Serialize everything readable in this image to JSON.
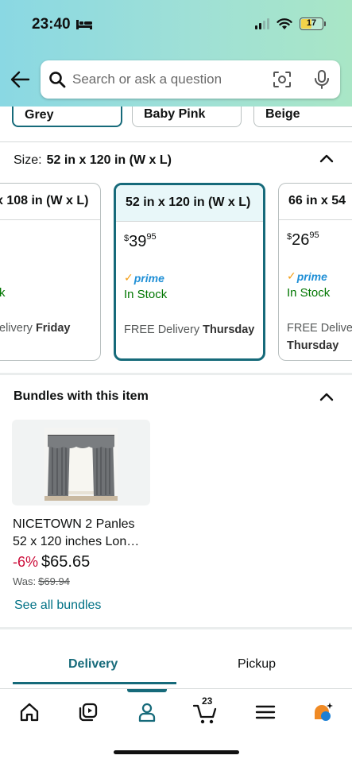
{
  "status_bar": {
    "time": "23:40",
    "battery": "17"
  },
  "search": {
    "placeholder": "Search or ask a question"
  },
  "colors": {
    "options": [
      "Grey",
      "Baby Pink",
      "Beige"
    ],
    "selected": "Grey"
  },
  "size": {
    "label": "Size:",
    "selected": "52 in x 120 in (W x L)",
    "cards": [
      {
        "title": "x 108 in (W x L)",
        "stock": "k",
        "delivery_prefix": "elivery",
        "delivery_day": "Friday"
      },
      {
        "title": "52 in x 120 in (W x L)",
        "price_currency": "$",
        "price_whole": "39",
        "price_fraction": "95",
        "prime_label": "prime",
        "stock": "In Stock",
        "delivery_prefix": "FREE Delivery",
        "delivery_day": "Thursday"
      },
      {
        "title": "66 in x 54",
        "price_currency": "$",
        "price_whole": "26",
        "price_fraction": "95",
        "prime_label": "prime",
        "stock": "In Stock",
        "delivery_prefix": "FREE Deliver",
        "delivery_day": "Thursday"
      }
    ]
  },
  "bundles": {
    "title": "Bundles with this item",
    "item": {
      "name_line1": "NICETOWN 2 Panles",
      "name_line2": "52 x 120 inches Lon…",
      "discount": "-6%",
      "price": "$65.65",
      "was_label": "Was:",
      "was_price": "$69.94"
    },
    "see_all": "See all bundles"
  },
  "tabs": {
    "delivery": "Delivery",
    "pickup": "Pickup",
    "active": "Delivery"
  },
  "bottom_nav": {
    "items": [
      "home",
      "inspire",
      "account",
      "cart",
      "menu",
      "rufus"
    ],
    "active": "account",
    "cart_count": "23"
  },
  "colors_theme": {
    "accent": "#166a7a",
    "link": "#007185",
    "in_stock": "#007600",
    "discount": "#cc0c39",
    "prime_blue": "#1f8fd6"
  }
}
